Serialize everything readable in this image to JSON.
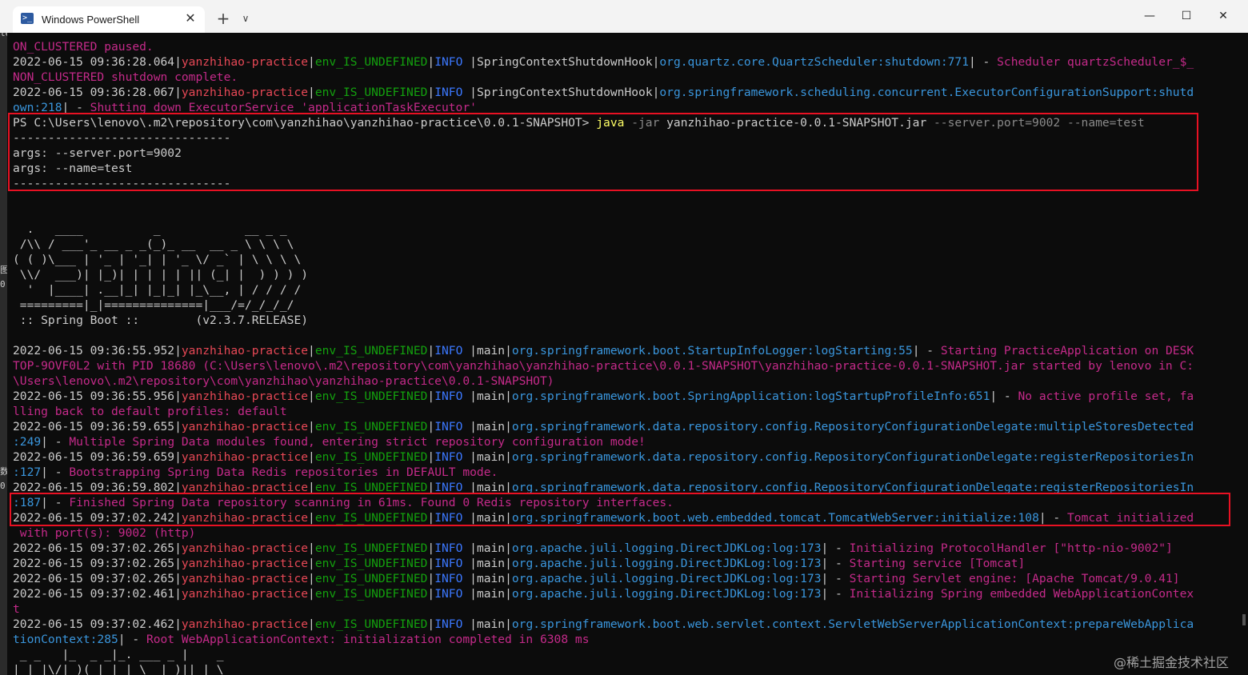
{
  "window": {
    "tab_title": "Windows PowerShell",
    "tab_icon": "powershell-icon",
    "new_tab_symbol": "+",
    "dropdown_symbol": "∨",
    "close_tab_symbol": "✕",
    "controls": {
      "minimize": "—",
      "maximize": "☐",
      "close": "✕"
    }
  },
  "colors": {
    "background": "#0c0c0c",
    "text": "#cccccc",
    "app_name": "#e74856",
    "env": "#13a10e",
    "level": "#3b78ff",
    "logger": "#3a96dd",
    "message": "#c01c7a",
    "highlight_box": "#e81123"
  },
  "left_strip_chars": [
    "le",
    "图",
    "0",
    "数",
    "0"
  ],
  "terminal": {
    "lines": [
      [
        {
          "t": "ON_CLUSTERED paused.",
          "c": "mm"
        }
      ],
      [
        {
          "t": "2022-06-15 09:36:28.064|",
          "c": "w"
        },
        {
          "t": "yanzhihao-practice",
          "c": "r"
        },
        {
          "t": "|",
          "c": "w"
        },
        {
          "t": "env_IS_UNDEFINED",
          "c": "g"
        },
        {
          "t": "|",
          "c": "w"
        },
        {
          "t": "INFO",
          "c": "b"
        },
        {
          "t": " |SpringContextShutdownHook|",
          "c": "w"
        },
        {
          "t": "org.quartz.core.QuartzScheduler:shutdown:771",
          "c": "c"
        },
        {
          "t": "| - ",
          "c": "w"
        },
        {
          "t": "Scheduler quartzScheduler_$_",
          "c": "mm"
        }
      ],
      [
        {
          "t": "NON_CLUSTERED shutdown complete.",
          "c": "mm"
        }
      ],
      [
        {
          "t": "2022-06-15 09:36:28.067|",
          "c": "w"
        },
        {
          "t": "yanzhihao-practice",
          "c": "r"
        },
        {
          "t": "|",
          "c": "w"
        },
        {
          "t": "env_IS_UNDEFINED",
          "c": "g"
        },
        {
          "t": "|",
          "c": "w"
        },
        {
          "t": "INFO",
          "c": "b"
        },
        {
          "t": " |SpringContextShutdownHook|",
          "c": "w"
        },
        {
          "t": "org.springframework.scheduling.concurrent.ExecutorConfigurationSupport:shutd",
          "c": "c"
        }
      ],
      [
        {
          "t": "own:218",
          "c": "c"
        },
        {
          "t": "| - ",
          "c": "w"
        },
        {
          "t": "Shutting down ExecutorService 'applicationTaskExecutor'",
          "c": "mm"
        }
      ],
      [
        {
          "t": "PS C:\\Users\\lenovo\\.m2\\repository\\com\\yanzhihao\\yanzhihao-practice\\0.0.1-SNAPSHOT> ",
          "c": "w"
        },
        {
          "t": "java",
          "c": "y"
        },
        {
          "t": " -jar",
          "c": "gr"
        },
        {
          "t": " yanzhihao-practice-0.0.1-SNAPSHOT.jar",
          "c": "w"
        },
        {
          "t": " --server.port=9002 --name=test",
          "c": "gr"
        }
      ],
      [
        {
          "t": "-------------------------------",
          "c": "w"
        }
      ],
      [
        {
          "t": "args: --server.port=9002",
          "c": "w"
        }
      ],
      [
        {
          "t": "args: --name=test",
          "c": "w"
        }
      ],
      [
        {
          "t": "-------------------------------",
          "c": "w"
        }
      ],
      [
        {
          "t": "",
          "c": "w"
        }
      ],
      [
        {
          "t": "",
          "c": "w"
        }
      ],
      [
        {
          "t": "  .   ____          _            __ _ _",
          "c": "w"
        }
      ],
      [
        {
          "t": " /\\\\ / ___'_ __ _ _(_)_ __  __ _ \\ \\ \\ \\",
          "c": "w"
        }
      ],
      [
        {
          "t": "( ( )\\___ | '_ | '_| | '_ \\/ _` | \\ \\ \\ \\",
          "c": "w"
        }
      ],
      [
        {
          "t": " \\\\/  ___)| |_)| | | | | || (_| |  ) ) ) )",
          "c": "w"
        }
      ],
      [
        {
          "t": "  '  |____| .__|_| |_|_| |_\\__, | / / / /",
          "c": "w"
        }
      ],
      [
        {
          "t": " =========|_|==============|___/=/_/_/_/",
          "c": "w"
        }
      ],
      [
        {
          "t": " :: Spring Boot ::        (v2.3.7.RELEASE)",
          "c": "w"
        }
      ],
      [
        {
          "t": "",
          "c": "w"
        }
      ],
      [
        {
          "t": "2022-06-15 09:36:55.952|",
          "c": "w"
        },
        {
          "t": "yanzhihao-practice",
          "c": "r"
        },
        {
          "t": "|",
          "c": "w"
        },
        {
          "t": "env_IS_UNDEFINED",
          "c": "g"
        },
        {
          "t": "|",
          "c": "w"
        },
        {
          "t": "INFO",
          "c": "b"
        },
        {
          "t": " |main|",
          "c": "w"
        },
        {
          "t": "org.springframework.boot.StartupInfoLogger:logStarting:55",
          "c": "c"
        },
        {
          "t": "| - ",
          "c": "w"
        },
        {
          "t": "Starting PracticeApplication on DESK",
          "c": "mm"
        }
      ],
      [
        {
          "t": "TOP-9OVF0L2 with PID 18680 (C:\\Users\\lenovo\\.m2\\repository\\com\\yanzhihao\\yanzhihao-practice\\0.0.1-SNAPSHOT\\yanzhihao-practice-0.0.1-SNAPSHOT.jar started by lenovo in C:",
          "c": "mm"
        }
      ],
      [
        {
          "t": "\\Users\\lenovo\\.m2\\repository\\com\\yanzhihao\\yanzhihao-practice\\0.0.1-SNAPSHOT)",
          "c": "mm"
        }
      ],
      [
        {
          "t": "2022-06-15 09:36:55.956|",
          "c": "w"
        },
        {
          "t": "yanzhihao-practice",
          "c": "r"
        },
        {
          "t": "|",
          "c": "w"
        },
        {
          "t": "env_IS_UNDEFINED",
          "c": "g"
        },
        {
          "t": "|",
          "c": "w"
        },
        {
          "t": "INFO",
          "c": "b"
        },
        {
          "t": " |main|",
          "c": "w"
        },
        {
          "t": "org.springframework.boot.SpringApplication:logStartupProfileInfo:651",
          "c": "c"
        },
        {
          "t": "| - ",
          "c": "w"
        },
        {
          "t": "No active profile set, fa",
          "c": "mm"
        }
      ],
      [
        {
          "t": "lling back to default profiles: default",
          "c": "mm"
        }
      ],
      [
        {
          "t": "2022-06-15 09:36:59.655|",
          "c": "w"
        },
        {
          "t": "yanzhihao-practice",
          "c": "r"
        },
        {
          "t": "|",
          "c": "w"
        },
        {
          "t": "env_IS_UNDEFINED",
          "c": "g"
        },
        {
          "t": "|",
          "c": "w"
        },
        {
          "t": "INFO",
          "c": "b"
        },
        {
          "t": " |main|",
          "c": "w"
        },
        {
          "t": "org.springframework.data.repository.config.RepositoryConfigurationDelegate:multipleStoresDetected",
          "c": "c"
        }
      ],
      [
        {
          "t": ":249",
          "c": "c"
        },
        {
          "t": "| - ",
          "c": "w"
        },
        {
          "t": "Multiple Spring Data modules found, entering strict repository configuration mode!",
          "c": "mm"
        }
      ],
      [
        {
          "t": "2022-06-15 09:36:59.659|",
          "c": "w"
        },
        {
          "t": "yanzhihao-practice",
          "c": "r"
        },
        {
          "t": "|",
          "c": "w"
        },
        {
          "t": "env_IS_UNDEFINED",
          "c": "g"
        },
        {
          "t": "|",
          "c": "w"
        },
        {
          "t": "INFO",
          "c": "b"
        },
        {
          "t": " |main|",
          "c": "w"
        },
        {
          "t": "org.springframework.data.repository.config.RepositoryConfigurationDelegate:registerRepositoriesIn",
          "c": "c"
        }
      ],
      [
        {
          "t": ":127",
          "c": "c"
        },
        {
          "t": "| - ",
          "c": "w"
        },
        {
          "t": "Bootstrapping Spring Data Redis repositories in DEFAULT mode.",
          "c": "mm"
        }
      ],
      [
        {
          "t": "2022-06-15 09:36:59.802|",
          "c": "w"
        },
        {
          "t": "yanzhihao-practice",
          "c": "r"
        },
        {
          "t": "|",
          "c": "w"
        },
        {
          "t": "env_IS_UNDEFINED",
          "c": "g"
        },
        {
          "t": "|",
          "c": "w"
        },
        {
          "t": "INFO",
          "c": "b"
        },
        {
          "t": " |main|",
          "c": "w"
        },
        {
          "t": "org.springframework.data.repository.config.RepositoryConfigurationDelegate:registerRepositoriesIn",
          "c": "c"
        }
      ],
      [
        {
          "t": ":187",
          "c": "c"
        },
        {
          "t": "| - ",
          "c": "w"
        },
        {
          "t": "Finished Spring Data repository scanning in 61ms. Found 0 Redis repository interfaces.",
          "c": "mm"
        }
      ],
      [
        {
          "t": "2022-06-15 09:37:02.242|",
          "c": "w"
        },
        {
          "t": "yanzhihao-practice",
          "c": "r"
        },
        {
          "t": "|",
          "c": "w"
        },
        {
          "t": "env_IS_UNDEFINED",
          "c": "g"
        },
        {
          "t": "|",
          "c": "w"
        },
        {
          "t": "INFO",
          "c": "b"
        },
        {
          "t": " |main|",
          "c": "w"
        },
        {
          "t": "org.springframework.boot.web.embedded.tomcat.TomcatWebServer:initialize:108",
          "c": "c"
        },
        {
          "t": "| - ",
          "c": "w"
        },
        {
          "t": "Tomcat initialized",
          "c": "mm"
        }
      ],
      [
        {
          "t": " with port(s): 9002 (http)",
          "c": "mm"
        }
      ],
      [
        {
          "t": "2022-06-15 09:37:02.265|",
          "c": "w"
        },
        {
          "t": "yanzhihao-practice",
          "c": "r"
        },
        {
          "t": "|",
          "c": "w"
        },
        {
          "t": "env_IS_UNDEFINED",
          "c": "g"
        },
        {
          "t": "|",
          "c": "w"
        },
        {
          "t": "INFO",
          "c": "b"
        },
        {
          "t": " |main|",
          "c": "w"
        },
        {
          "t": "org.apache.juli.logging.DirectJDKLog:log:173",
          "c": "c"
        },
        {
          "t": "| - ",
          "c": "w"
        },
        {
          "t": "Initializing ProtocolHandler [\"http-nio-9002\"]",
          "c": "mm"
        }
      ],
      [
        {
          "t": "2022-06-15 09:37:02.265|",
          "c": "w"
        },
        {
          "t": "yanzhihao-practice",
          "c": "r"
        },
        {
          "t": "|",
          "c": "w"
        },
        {
          "t": "env_IS_UNDEFINED",
          "c": "g"
        },
        {
          "t": "|",
          "c": "w"
        },
        {
          "t": "INFO",
          "c": "b"
        },
        {
          "t": " |main|",
          "c": "w"
        },
        {
          "t": "org.apache.juli.logging.DirectJDKLog:log:173",
          "c": "c"
        },
        {
          "t": "| - ",
          "c": "w"
        },
        {
          "t": "Starting service [Tomcat]",
          "c": "mm"
        }
      ],
      [
        {
          "t": "2022-06-15 09:37:02.265|",
          "c": "w"
        },
        {
          "t": "yanzhihao-practice",
          "c": "r"
        },
        {
          "t": "|",
          "c": "w"
        },
        {
          "t": "env_IS_UNDEFINED",
          "c": "g"
        },
        {
          "t": "|",
          "c": "w"
        },
        {
          "t": "INFO",
          "c": "b"
        },
        {
          "t": " |main|",
          "c": "w"
        },
        {
          "t": "org.apache.juli.logging.DirectJDKLog:log:173",
          "c": "c"
        },
        {
          "t": "| - ",
          "c": "w"
        },
        {
          "t": "Starting Servlet engine: [Apache Tomcat/9.0.41]",
          "c": "mm"
        }
      ],
      [
        {
          "t": "2022-06-15 09:37:02.461|",
          "c": "w"
        },
        {
          "t": "yanzhihao-practice",
          "c": "r"
        },
        {
          "t": "|",
          "c": "w"
        },
        {
          "t": "env_IS_UNDEFINED",
          "c": "g"
        },
        {
          "t": "|",
          "c": "w"
        },
        {
          "t": "INFO",
          "c": "b"
        },
        {
          "t": " |main|",
          "c": "w"
        },
        {
          "t": "org.apache.juli.logging.DirectJDKLog:log:173",
          "c": "c"
        },
        {
          "t": "| - ",
          "c": "w"
        },
        {
          "t": "Initializing Spring embedded WebApplicationContex",
          "c": "mm"
        }
      ],
      [
        {
          "t": "t",
          "c": "mm"
        }
      ],
      [
        {
          "t": "2022-06-15 09:37:02.462|",
          "c": "w"
        },
        {
          "t": "yanzhihao-practice",
          "c": "r"
        },
        {
          "t": "|",
          "c": "w"
        },
        {
          "t": "env_IS_UNDEFINED",
          "c": "g"
        },
        {
          "t": "|",
          "c": "w"
        },
        {
          "t": "INFO",
          "c": "b"
        },
        {
          "t": " |main|",
          "c": "w"
        },
        {
          "t": "org.springframework.boot.web.servlet.context.ServletWebServerApplicationContext:prepareWebApplica",
          "c": "c"
        }
      ],
      [
        {
          "t": "tionContext:285",
          "c": "c"
        },
        {
          "t": "| - ",
          "c": "w"
        },
        {
          "t": "Root WebApplicationContext: initialization completed in 6308 ms",
          "c": "mm"
        }
      ],
      [
        {
          "t": " _ _   |_  _ _|_. ___ _ |    _",
          "c": "w"
        }
      ],
      [
        {
          "t": "| | |\\/|_)(_| | |_\\  |_)||_|_\\",
          "c": "w"
        }
      ]
    ]
  },
  "watermark": "@稀土掘金技术社区"
}
